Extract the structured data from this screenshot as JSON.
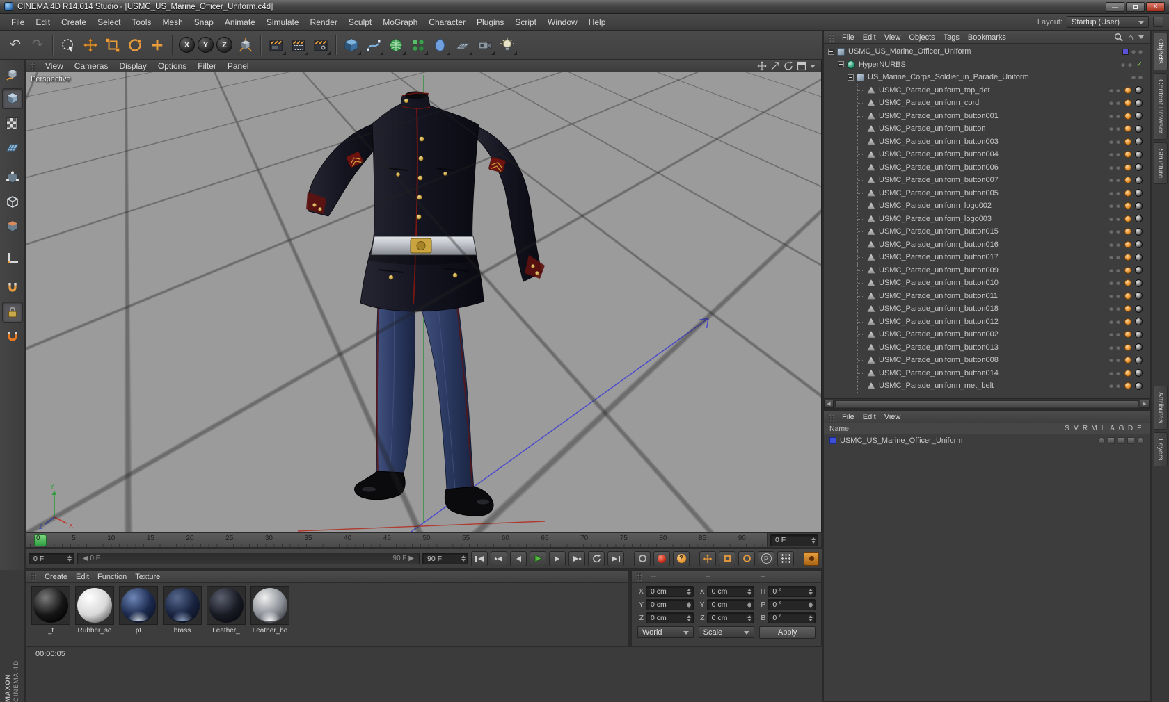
{
  "window": {
    "title": "CINEMA 4D R14.014 Studio - [USMC_US_Marine_Officer_Uniform.c4d]"
  },
  "menubar": {
    "items": [
      "File",
      "Edit",
      "Create",
      "Select",
      "Tools",
      "Mesh",
      "Snap",
      "Animate",
      "Simulate",
      "Render",
      "Sculpt",
      "MoGraph",
      "Character",
      "Plugins",
      "Script",
      "Window",
      "Help"
    ],
    "layout_label": "Layout:",
    "layout_value": "Startup (User)"
  },
  "toolbar": {
    "axis": [
      "X",
      "Y",
      "Z"
    ]
  },
  "viewport": {
    "menus": [
      "View",
      "Cameras",
      "Display",
      "Options",
      "Filter",
      "Panel"
    ],
    "label": "Perspective",
    "gizmo": {
      "x": "X",
      "y": "Y",
      "z": "Z"
    }
  },
  "object_manager": {
    "menus": [
      "File",
      "Edit",
      "View",
      "Objects",
      "Tags",
      "Bookmarks"
    ],
    "tree": [
      {
        "name": "USMC_US_Marine_Officer_Uniform",
        "level": 0,
        "icon": "null",
        "expander": true,
        "dots": true,
        "layer": "#5b50d8"
      },
      {
        "name": "HyperNURBS",
        "level": 1,
        "icon": "hn",
        "expander": true,
        "dots": true,
        "check": "✓"
      },
      {
        "name": "US_Marine_Corps_Soldier_in_Parade_Uniform",
        "level": 2,
        "icon": "null",
        "expander": true,
        "dots": true
      },
      {
        "name": "USMC_Parade_uniform_top_det",
        "level": 3,
        "icon": "poly",
        "branch": true,
        "dots": true,
        "tag_phong": true,
        "tag_tex": true
      },
      {
        "name": "USMC_Parade_uniform_cord",
        "level": 3,
        "icon": "poly",
        "branch": true,
        "dots": true,
        "tag_phong": true,
        "tag_tex": true
      },
      {
        "name": "USMC_Parade_uniform_button001",
        "level": 3,
        "icon": "poly",
        "branch": true,
        "dots": true,
        "tag_phong": true,
        "tag_tex": true
      },
      {
        "name": "USMC_Parade_uniform_button",
        "level": 3,
        "icon": "poly",
        "branch": true,
        "dots": true,
        "tag_phong": true,
        "tag_tex": true
      },
      {
        "name": "USMC_Parade_uniform_button003",
        "level": 3,
        "icon": "poly",
        "branch": true,
        "dots": true,
        "tag_phong": true,
        "tag_tex": true
      },
      {
        "name": "USMC_Parade_uniform_button004",
        "level": 3,
        "icon": "poly",
        "branch": true,
        "dots": true,
        "tag_phong": true,
        "tag_tex": true
      },
      {
        "name": "USMC_Parade_uniform_button006",
        "level": 3,
        "icon": "poly",
        "branch": true,
        "dots": true,
        "tag_phong": true,
        "tag_tex": true
      },
      {
        "name": "USMC_Parade_uniform_button007",
        "level": 3,
        "icon": "poly",
        "branch": true,
        "dots": true,
        "tag_phong": true,
        "tag_tex": true
      },
      {
        "name": "USMC_Parade_uniform_button005",
        "level": 3,
        "icon": "poly",
        "branch": true,
        "dots": true,
        "tag_phong": true,
        "tag_tex": true
      },
      {
        "name": "USMC_Parade_uniform_logo002",
        "level": 3,
        "icon": "poly",
        "branch": true,
        "dots": true,
        "tag_phong": true,
        "tag_tex": true
      },
      {
        "name": "USMC_Parade_uniform_logo003",
        "level": 3,
        "icon": "poly",
        "branch": true,
        "dots": true,
        "tag_phong": true,
        "tag_tex": true
      },
      {
        "name": "USMC_Parade_uniform_button015",
        "level": 3,
        "icon": "poly",
        "branch": true,
        "dots": true,
        "tag_phong": true,
        "tag_tex": true
      },
      {
        "name": "USMC_Parade_uniform_button016",
        "level": 3,
        "icon": "poly",
        "branch": true,
        "dots": true,
        "tag_phong": true,
        "tag_tex": true
      },
      {
        "name": "USMC_Parade_uniform_button017",
        "level": 3,
        "icon": "poly",
        "branch": true,
        "dots": true,
        "tag_phong": true,
        "tag_tex": true
      },
      {
        "name": "USMC_Parade_uniform_button009",
        "level": 3,
        "icon": "poly",
        "branch": true,
        "dots": true,
        "tag_phong": true,
        "tag_tex": true
      },
      {
        "name": "USMC_Parade_uniform_button010",
        "level": 3,
        "icon": "poly",
        "branch": true,
        "dots": true,
        "tag_phong": true,
        "tag_tex": true
      },
      {
        "name": "USMC_Parade_uniform_button011",
        "level": 3,
        "icon": "poly",
        "branch": true,
        "dots": true,
        "tag_phong": true,
        "tag_tex": true
      },
      {
        "name": "USMC_Parade_uniform_button018",
        "level": 3,
        "icon": "poly",
        "branch": true,
        "dots": true,
        "tag_phong": true,
        "tag_tex": true
      },
      {
        "name": "USMC_Parade_uniform_button012",
        "level": 3,
        "icon": "poly",
        "branch": true,
        "dots": true,
        "tag_phong": true,
        "tag_tex": true
      },
      {
        "name": "USMC_Parade_uniform_button002",
        "level": 3,
        "icon": "poly",
        "branch": true,
        "dots": true,
        "tag_phong": true,
        "tag_tex": true
      },
      {
        "name": "USMC_Parade_uniform_button013",
        "level": 3,
        "icon": "poly",
        "branch": true,
        "dots": true,
        "tag_phong": true,
        "tag_tex": true
      },
      {
        "name": "USMC_Parade_uniform_button008",
        "level": 3,
        "icon": "poly",
        "branch": true,
        "dots": true,
        "tag_phong": true,
        "tag_tex": true
      },
      {
        "name": "USMC_Parade_uniform_button014",
        "level": 3,
        "icon": "poly",
        "branch": true,
        "dots": true,
        "tag_phong": true,
        "tag_tex": true
      },
      {
        "name": "USMC_Parade_uniform_met_belt",
        "level": 3,
        "icon": "poly",
        "branch": true,
        "dots": true,
        "tag_phong": true,
        "tag_tex": true
      }
    ]
  },
  "lower_panel": {
    "menus": [
      "File",
      "Edit",
      "View"
    ],
    "name_header": "Name",
    "columns": [
      "S",
      "V",
      "R",
      "M",
      "L",
      "A",
      "G",
      "D",
      "E"
    ],
    "item": {
      "name": "USMC_US_Marine_Officer_Uniform",
      "color": "#3d4fd8"
    }
  },
  "side_tabs": [
    "Objects",
    "Content Browser",
    "Structure",
    "Attributes",
    "Layers"
  ],
  "timeline": {
    "ticks": [
      "0",
      "5",
      "10",
      "15",
      "20",
      "25",
      "30",
      "35",
      "40",
      "45",
      "50",
      "55",
      "60",
      "65",
      "70",
      "75",
      "80",
      "85",
      "90"
    ],
    "frame_field": "0 F"
  },
  "transport": {
    "frame_start": "0 F",
    "range_start": "◀ 0 F",
    "range_end": "90 F ▶",
    "frame_end": "90 F",
    "help": "?",
    "param": "P"
  },
  "materials": {
    "menus": [
      "Create",
      "Edit",
      "Function",
      "Texture"
    ],
    "items": [
      {
        "name": "_t",
        "hi": "#7a7a7a",
        "c1": "#161616",
        "c2": "#000000",
        "rim": "transparent"
      },
      {
        "name": "Rubber_so",
        "hi": "#ffffff",
        "c1": "#d8d8d8",
        "c2": "#585858",
        "rim": "transparent"
      },
      {
        "name": "pt",
        "hi": "#6e86b8",
        "c1": "#1c2a4e",
        "c2": "#0b1226",
        "rim": "#cdd5de"
      },
      {
        "name": "brass",
        "hi": "#56688e",
        "c1": "#18233f",
        "c2": "#0a0f1d",
        "rim": "#8fa0c0"
      },
      {
        "name": "Leather_",
        "hi": "#5c6170",
        "c1": "#191b24",
        "c2": "#07080d",
        "rim": "transparent"
      },
      {
        "name": "Leather_bo",
        "hi": "#f0f0f0",
        "c1": "#8c9097",
        "c2": "#35383d",
        "rim": "#ffffff"
      }
    ]
  },
  "coordinates": {
    "headers": [
      "--",
      "--",
      "--"
    ],
    "cells": [
      {
        "l": "X",
        "v": "0 cm"
      },
      {
        "l": "X",
        "v": "0 cm"
      },
      {
        "l": "H",
        "v": "0 °"
      },
      {
        "l": "Y",
        "v": "0 cm"
      },
      {
        "l": "Y",
        "v": "0 cm"
      },
      {
        "l": "P",
        "v": "0 °"
      },
      {
        "l": "Z",
        "v": "0 cm"
      },
      {
        "l": "Z",
        "v": "0 cm"
      },
      {
        "l": "B",
        "v": "0 °"
      }
    ],
    "space": "World",
    "mode": "Scale",
    "apply": "Apply"
  },
  "status": {
    "time": "00:00:05"
  },
  "branding": {
    "line1": "MAXON",
    "line2": "CINEMA 4D"
  }
}
